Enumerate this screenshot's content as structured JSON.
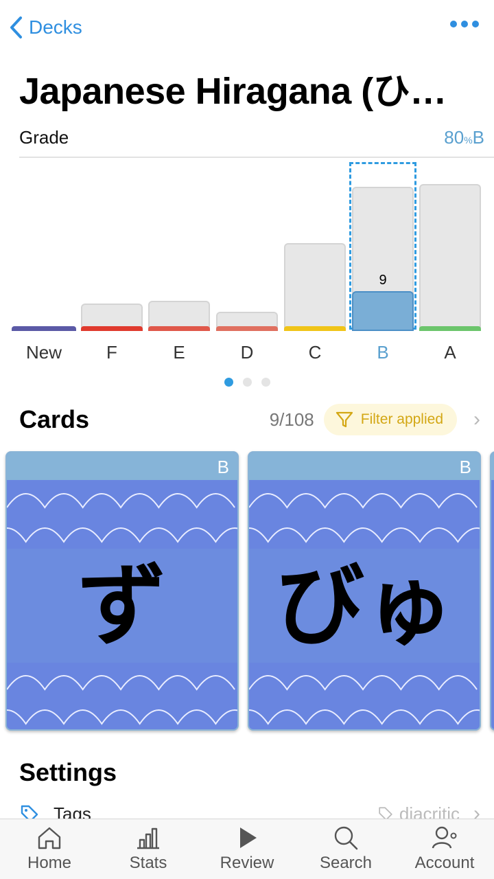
{
  "nav": {
    "back_label": "Decks"
  },
  "title": "Japanese Hiragana (ひ…",
  "grade": {
    "label": "Grade",
    "percent": "80",
    "percent_sign": "%",
    "letter": "B"
  },
  "chart_data": {
    "type": "bar",
    "categories": [
      "New",
      "F",
      "E",
      "D",
      "C",
      "B",
      "A"
    ],
    "selected": "B",
    "selected_count_label": "9",
    "selected_value": 9,
    "colors": {
      "New": "#5b5aa6",
      "F": "#e03a2e",
      "E": "#e0584a",
      "D": "#e07060",
      "C": "#f0c419",
      "B": "#5aa0cf",
      "A": "#6cc56c"
    }
  },
  "pager": {
    "pages": 3,
    "active": 0
  },
  "cards_section": {
    "title": "Cards",
    "count": "9/108",
    "filter_label": "Filter applied",
    "cards": [
      {
        "grade": "B",
        "kana": "ず"
      },
      {
        "grade": "B",
        "kana": "びゅ"
      }
    ]
  },
  "settings": {
    "title": "Settings",
    "tags_label": "Tags",
    "tags_value": "diacritic"
  },
  "tabbar": [
    "Home",
    "Stats",
    "Review",
    "Search",
    "Account"
  ]
}
